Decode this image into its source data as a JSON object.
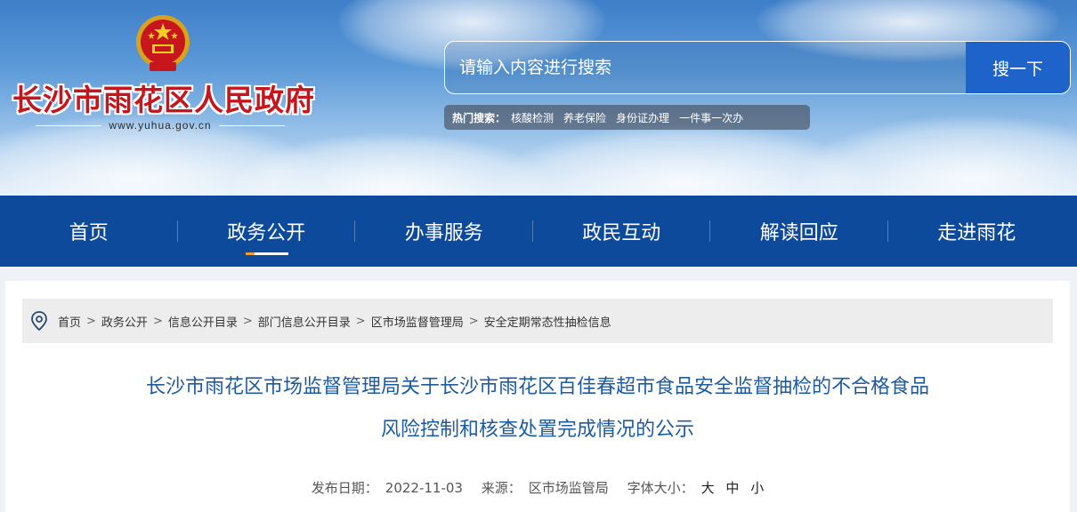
{
  "header": {
    "site_title": "长沙市雨花区人民政府",
    "site_url": "www.yuhua.gov.cn"
  },
  "search": {
    "placeholder": "请输入内容进行搜索",
    "button_label": "搜一下",
    "hot_label": "热门搜索：",
    "hot_items": [
      "核酸检测",
      "养老保险",
      "身份证办理",
      "一件事一次办"
    ]
  },
  "nav": {
    "items": [
      {
        "label": "首页"
      },
      {
        "label": "政务公开"
      },
      {
        "label": "办事服务"
      },
      {
        "label": "政民互动"
      },
      {
        "label": "解读回应"
      },
      {
        "label": "走进雨花"
      }
    ],
    "active_index": 1
  },
  "breadcrumb": {
    "items": [
      "首页",
      "政务公开",
      "信息公开目录",
      "部门信息公开目录",
      "区市场监督管理局",
      "安全定期常态性抽检信息"
    ],
    "separator": ">"
  },
  "article": {
    "title_line1": "长沙市雨花区市场监督管理局关于长沙市雨花区百佳春超市食品安全监督抽检的不合格食品",
    "title_line2": "风险控制和核查处置完成情况的公示",
    "publish_label": "发布日期：",
    "publish_date": "2022-11-03",
    "source_label": "来源：",
    "source": "区市场监管局",
    "font_size_label": "字体大小：",
    "font_sizes": [
      "大",
      "中",
      "小"
    ]
  },
  "colors": {
    "nav_bg": "#0e4a9b",
    "title_red": "#c4161c",
    "search_button": "#1d63c9",
    "article_title": "#1e5a9e"
  },
  "icons": [
    "national-emblem-icon",
    "location-pin-icon"
  ]
}
